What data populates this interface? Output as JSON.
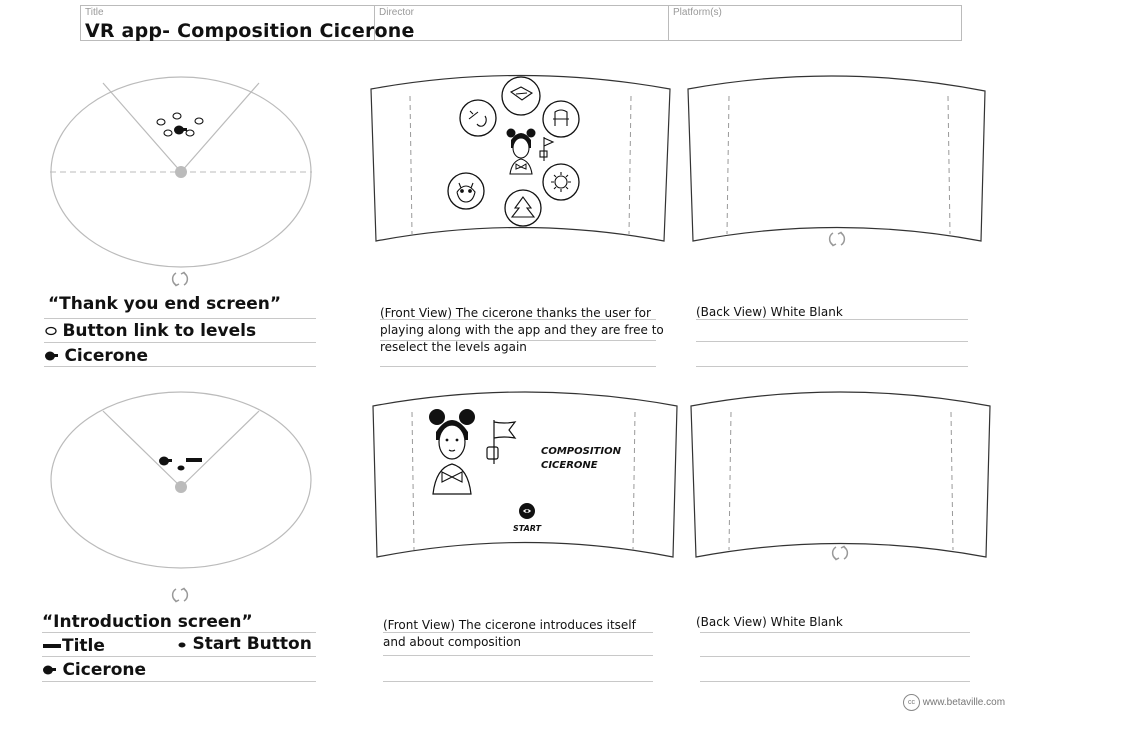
{
  "header": {
    "title_label": "Title",
    "title_value": "VR app- Composition Cicerone",
    "director_label": "Director",
    "platform_label": "Platform(s)"
  },
  "scene1": {
    "name": "“Thank you end screen”",
    "legend_button": "Button link to levels",
    "legend_cicerone": "Cicerone",
    "front_desc": "(Front View) The cicerone thanks the user for playing along with the app and they are free to reselect the levels again",
    "back_desc": "(Back View) White Blank"
  },
  "scene2": {
    "name": "“Introduction screen”",
    "legend_title": "Title",
    "legend_start": "Start Button",
    "legend_cicerone": "Cicerone",
    "front_desc": "(Front View) The cicerone introduces itself and about composition",
    "back_desc": "(Back View) White Blank",
    "screen_title_line1": "COMPOSITION",
    "screen_title_line2": "CICERONE",
    "start_label": "START"
  },
  "footer": {
    "cc_badge": "cc",
    "credit": "www.betaville.com"
  },
  "icons": {
    "rotate": "rotate-arrows-icon",
    "cicerone": "cicerone-figure-icon",
    "flag": "flag-icon"
  }
}
